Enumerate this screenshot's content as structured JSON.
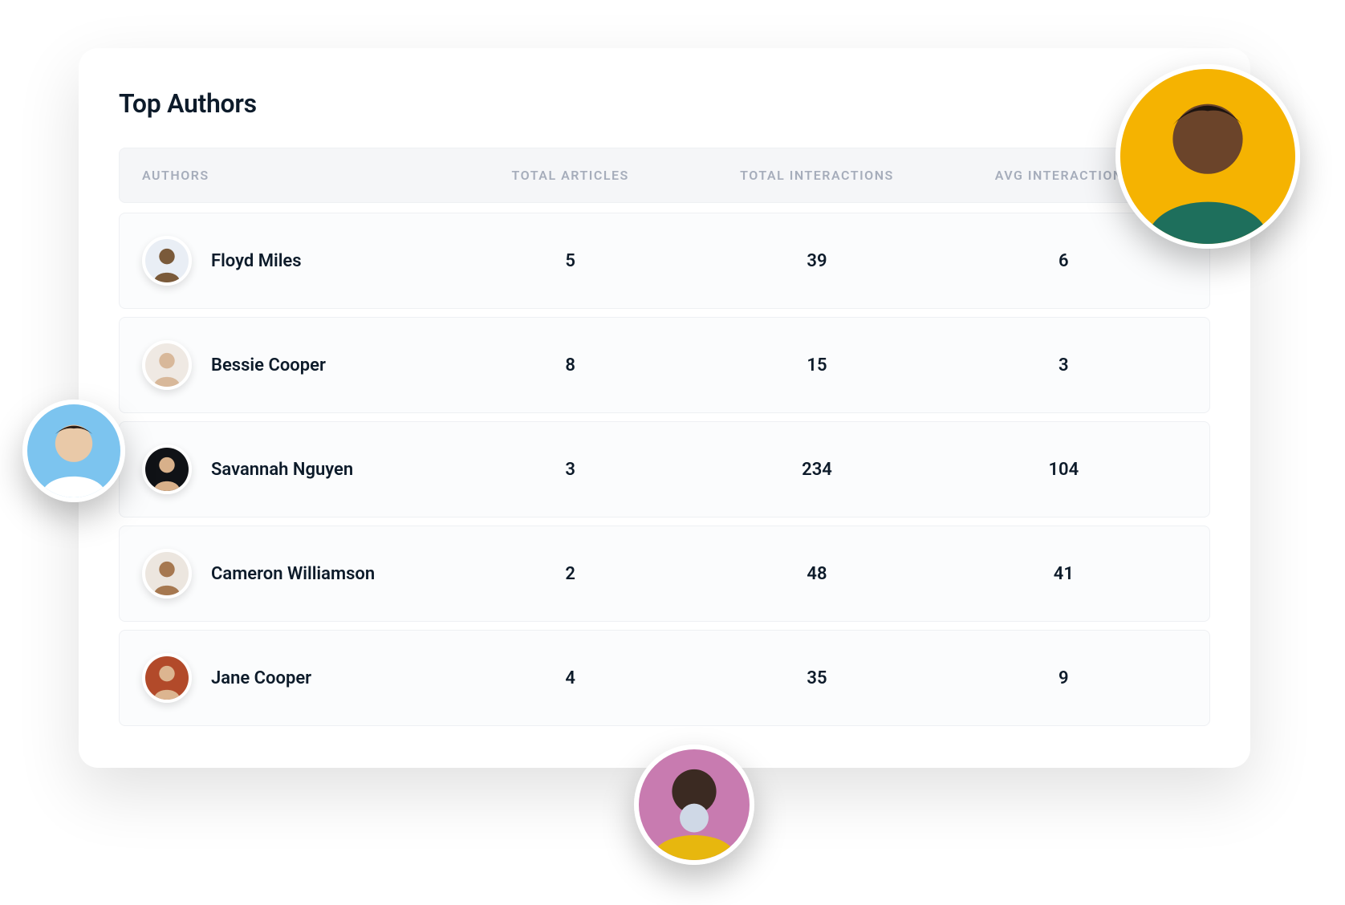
{
  "card": {
    "title": "Top Authors",
    "columns": {
      "authors": "AUTHORS",
      "total_articles": "TOTAL ARTICLES",
      "total_interactions": "TOTAL INTERACTIONS",
      "avg_interactions": "AVG INTERACTIONS"
    },
    "rows": [
      {
        "name": "Floyd Miles",
        "total_articles": "5",
        "total_interactions": "39",
        "avg_interactions": "6",
        "avatar_bg": "#e9eef5",
        "avatar_tone": "#7a5a3a"
      },
      {
        "name": "Bessie Cooper",
        "total_articles": "8",
        "total_interactions": "15",
        "avg_interactions": "3",
        "avatar_bg": "#efe9e3",
        "avatar_tone": "#d8b89a"
      },
      {
        "name": "Savannah Nguyen",
        "total_articles": "3",
        "total_interactions": "234",
        "avg_interactions": "104",
        "avatar_bg": "#101216",
        "avatar_tone": "#d8b08a"
      },
      {
        "name": "Cameron Williamson",
        "total_articles": "2",
        "total_interactions": "48",
        "avg_interactions": "41",
        "avatar_bg": "#ece6df",
        "avatar_tone": "#a67850"
      },
      {
        "name": "Jane Cooper",
        "total_articles": "4",
        "total_interactions": "35",
        "avg_interactions": "9",
        "avatar_bg": "#b24a2a",
        "avatar_tone": "#dcb590"
      }
    ]
  },
  "decorative_avatars": {
    "top_right": {
      "bg": "#f5b301",
      "tone": "#6b442a",
      "shirt": "#1e6f5c"
    },
    "left": {
      "bg": "#7cc4ef",
      "tone": "#e9c9a8",
      "shirt": "#ffffff"
    },
    "bottom": {
      "bg": "#c87bb0",
      "tone": "#3b2a22",
      "shirt": "#e7b70e"
    }
  }
}
